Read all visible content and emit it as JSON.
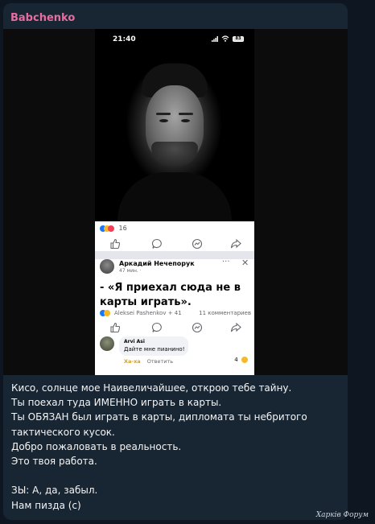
{
  "channel": {
    "sender": "Babchenko"
  },
  "screenshot": {
    "status_time": "21:40",
    "battery": "83",
    "reaction_count": "16",
    "post": {
      "author": "Аркадий Нечепорук",
      "posted": "47 мин. ·",
      "more": "···",
      "close": "✕",
      "quote": "- «Я приехал сюда не в карты играть».",
      "reactors": "Aleksei Pashenkov + 41",
      "comments": "11 комментариев"
    },
    "comment": {
      "author": "Arvi Asi",
      "text": "Дайте мне пианино!",
      "like_label": "Ха-ха",
      "reply_label": "Ответить",
      "reaction_count": "4"
    }
  },
  "message_lines": [
    "Кисо, солнце мое Наивеличайшее, открою тебе тайну.",
    "Ты поехал туда ИМЕННО играть в карты.",
    "Ты ОБЯЗАН был играть в карты, дипломата ты небритого",
    "тактического кусок.",
    "Добро пожаловать в реальность.",
    "Это твоя работа.",
    "",
    "ЗЫ: А, да, забыл.",
    "Нам пизда (с)"
  ],
  "watermark": "Харків Форум",
  "colors": {
    "background": "#0e1621",
    "bubble": "#182533",
    "sender": "#e56da1",
    "facebook_blue": "#1877f2"
  },
  "icons": [
    "signal-icon",
    "wifi-icon",
    "battery-icon",
    "like-icon",
    "comment-icon",
    "messenger-icon",
    "share-icon",
    "more-icon",
    "close-icon"
  ]
}
